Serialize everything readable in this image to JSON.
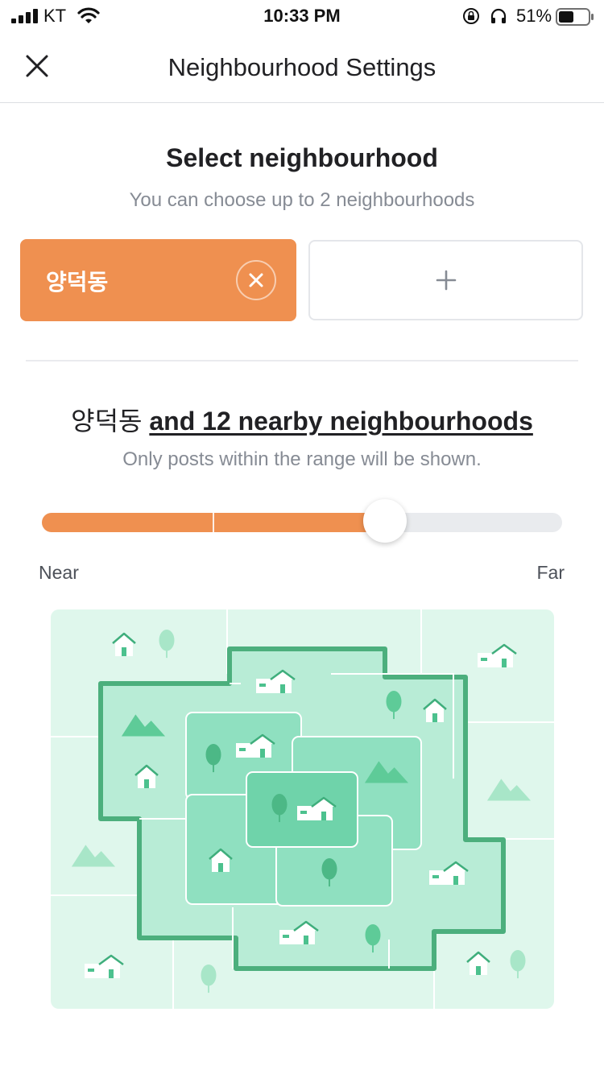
{
  "status_bar": {
    "carrier": "KT",
    "time": "10:33 PM",
    "battery_percent": "51%",
    "battery_level": 0.51,
    "icons": [
      "signal-icon",
      "wifi-icon",
      "orientation-lock-icon",
      "headphones-icon",
      "battery-icon"
    ]
  },
  "nav": {
    "title": "Neighbourhood Settings",
    "close_icon": "close-icon"
  },
  "select_section": {
    "title": "Select neighbourhood",
    "subtitle": "You can choose up to 2 neighbourhoods",
    "selected_neighbourhood": "양덕동",
    "remove_icon": "close-circle-icon",
    "add_icon": "plus-icon"
  },
  "range_section": {
    "neighbourhood": "양덕동",
    "nearby_text": "and 12 nearby neighbourhoods",
    "description": "Only posts within the range will be shown.",
    "slider": {
      "steps": 4,
      "current_step": 2,
      "value_fraction": 0.66
    },
    "near_label": "Near",
    "far_label": "Far"
  },
  "colors": {
    "accent": "#ef9050",
    "map_bg": "#dff7ec",
    "map_outer": "#b8ecd6",
    "map_inner": "#8fe0c0",
    "map_center": "#6fd3aa",
    "map_border": "#4caf7d"
  }
}
